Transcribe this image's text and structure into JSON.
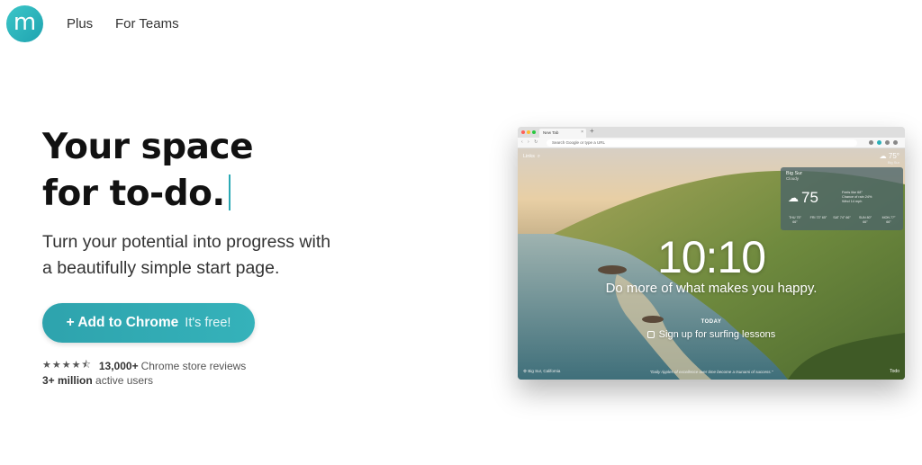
{
  "brand": {
    "logo_letter": "m",
    "color": "#2aa9b4"
  },
  "nav": {
    "items": [
      {
        "label": "Plus"
      },
      {
        "label": "For Teams"
      }
    ]
  },
  "hero": {
    "headline_line1": "Your space",
    "headline_line2": "for to-do.",
    "subtitle_line1": "Turn your potential into progress with",
    "subtitle_line2": "a beautifully simple start page.",
    "cta_label": "+ Add to Chrome",
    "cta_note": "It's free!",
    "rating": {
      "stars": 4.5,
      "reviews_count": "13,000+",
      "reviews_label": "Chrome store reviews"
    },
    "users": {
      "count": "3+ million",
      "label": "active users"
    }
  },
  "mockup": {
    "tab_title": "New Tab",
    "new_tab_symbol": "+",
    "address_placeholder": "Search Google or type a URL",
    "links_label": "Links",
    "mini_weather_temp": "75°",
    "mini_weather_location": "Big Sur",
    "weather": {
      "location": "Big Sur",
      "condition": "Cloudy",
      "temp": "75",
      "details": [
        "Feels like 68°",
        "Chance of rain 24%",
        "Wind 14 mph"
      ],
      "forecast": [
        "THU 75° 66°",
        "FRI 73° 65°",
        "SAT 74° 66°",
        "SUN 80° 66°",
        "MON 77° 66°"
      ]
    },
    "clock": "10:10",
    "mantra": "Do more of what makes you happy.",
    "today_label": "TODAY",
    "task": "Sign up for surfing lessons",
    "footer_left": "Big Sur, California",
    "quote": "\"Daily ripples of excellence over time become a tsunami of success.\"",
    "todo_label": "Todo"
  }
}
